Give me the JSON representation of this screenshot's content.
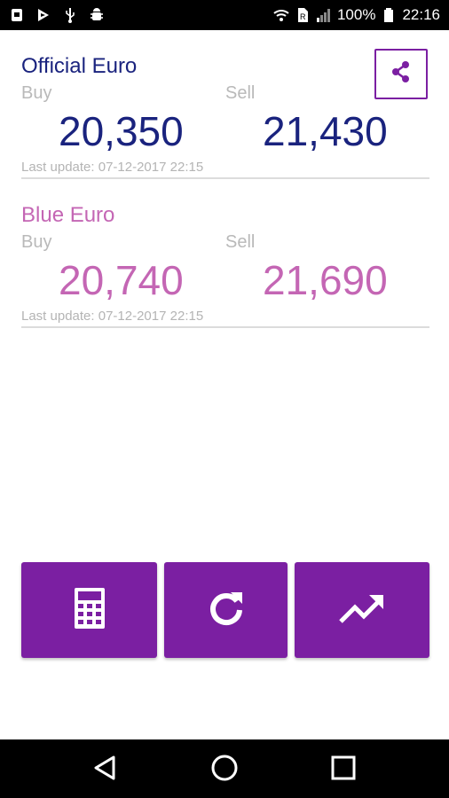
{
  "status_bar": {
    "battery_percent": "100%",
    "time": "22:16",
    "icons_left": [
      "deskclock-icon",
      "play-store-icon",
      "usb-icon",
      "android-debug-icon"
    ],
    "icons_right": [
      "wifi-icon",
      "sim-icon",
      "signal-icon",
      "battery-icon"
    ]
  },
  "official": {
    "title": "Official Euro",
    "buy_label": "Buy",
    "sell_label": "Sell",
    "buy_value": "20,350",
    "sell_value": "21,430",
    "last_update": "Last update: 07-12-2017 22:15",
    "color": "#1a237e"
  },
  "blue": {
    "title": "Blue Euro",
    "buy_label": "Buy",
    "sell_label": "Sell",
    "buy_value": "20,740",
    "sell_value": "21,690",
    "last_update": "Last update: 07-12-2017 22:15",
    "color": "#c466b4"
  },
  "share": {
    "icon": "share-icon",
    "accent": "#7b1fa2"
  },
  "actions": {
    "icons": [
      "calculator-icon",
      "refresh-icon",
      "trending-up-icon"
    ],
    "background": "#7b1fa2"
  },
  "nav": {
    "icons": [
      "back-icon",
      "home-icon",
      "recents-icon"
    ]
  }
}
